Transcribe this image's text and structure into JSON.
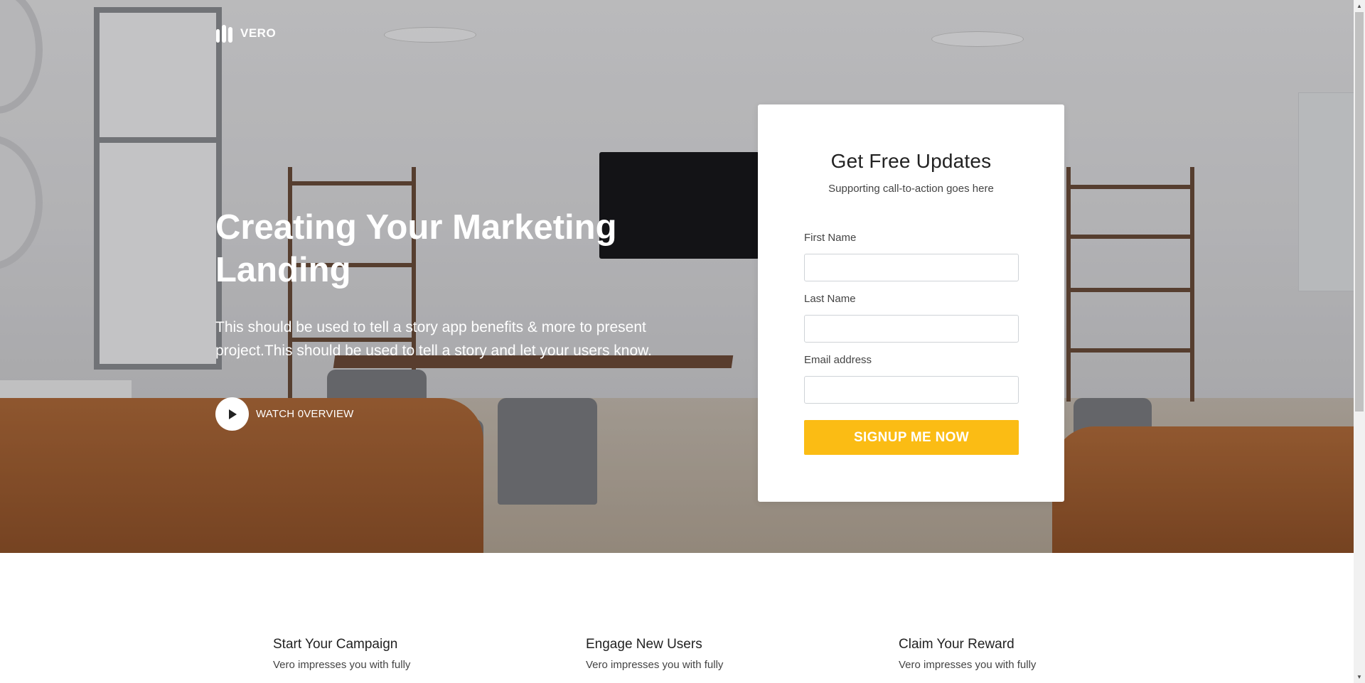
{
  "brand": {
    "name": "VERO",
    "logo_icon": "vero-logo-icon"
  },
  "hero": {
    "title": "Creating Your Marketing Landing",
    "description": "This should be used to tell a story app benefits & more to present project.This should be used to tell a story and let your users know.",
    "watch_label": "WATCH 0VERVIEW",
    "play_icon": "play-icon"
  },
  "form": {
    "title": "Get Free Updates",
    "subtitle": "Supporting call-to-action goes here",
    "fields": [
      {
        "label": "First Name",
        "value": "",
        "placeholder": ""
      },
      {
        "label": "Last Name",
        "value": "",
        "placeholder": ""
      },
      {
        "label": "Email address",
        "value": "",
        "placeholder": ""
      }
    ],
    "submit_label": "SIGNUP ME NOW",
    "accent_color": "#fbbc14"
  },
  "features": [
    {
      "title": "Start Your Campaign",
      "text": "Vero impresses you with fully"
    },
    {
      "title": "Engage New Users",
      "text": "Vero impresses you with fully"
    },
    {
      "title": "Claim Your Reward",
      "text": "Vero impresses you with fully"
    }
  ]
}
